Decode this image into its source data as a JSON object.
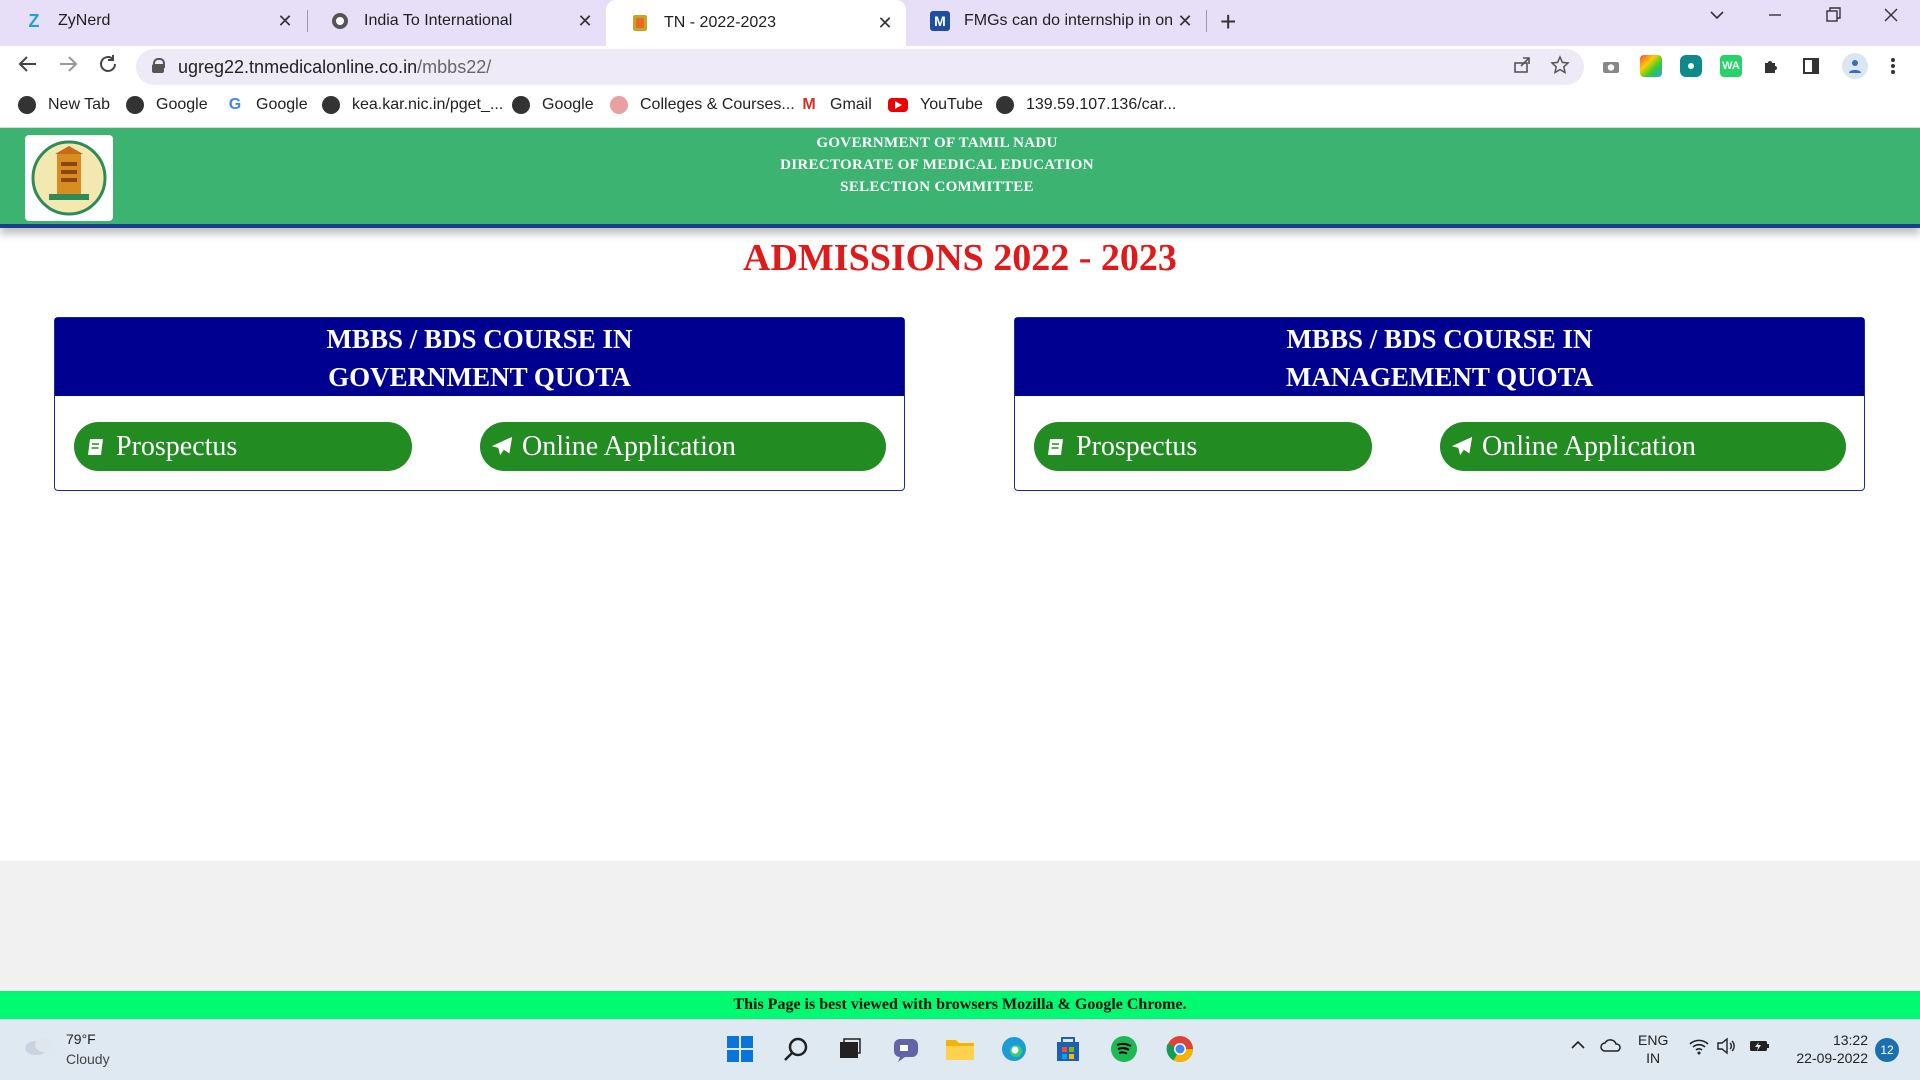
{
  "browser": {
    "tabs": [
      {
        "title": "ZyNerd",
        "favicon": "zynerd-icon",
        "active": false
      },
      {
        "title": "India To International",
        "favicon": "globe-icon",
        "active": false
      },
      {
        "title": "TN - 2022-2023",
        "favicon": "tn-emblem-icon",
        "active": true
      },
      {
        "title": "FMGs can do internship in only N",
        "favicon": "m-logo-icon",
        "active": false
      }
    ],
    "tab_close_glyph": "✕",
    "new_tab_glyph": "+",
    "url_host": "ugreg22.tnmedicalonline.co.in",
    "url_path": "/mbbs22/",
    "bookmarks": [
      {
        "label": "New Tab",
        "icon": "globe-icon"
      },
      {
        "label": "Google",
        "icon": "globe-icon"
      },
      {
        "label": "Google",
        "icon": "google-icon"
      },
      {
        "label": "kea.kar.nic.in/pget_...",
        "icon": "globe-icon"
      },
      {
        "label": "Google",
        "icon": "globe-icon"
      },
      {
        "label": "Colleges & Courses...",
        "icon": "colleges-icon"
      },
      {
        "label": "Gmail",
        "icon": "gmail-icon"
      },
      {
        "label": "YouTube",
        "icon": "youtube-icon"
      },
      {
        "label": "139.59.107.136/car...",
        "icon": "globe-icon"
      }
    ]
  },
  "page": {
    "header": {
      "line1": "GOVERNMENT OF TAMIL NADU",
      "line2": "DIRECTORATE OF MEDICAL EDUCATION",
      "line3": "SELECTION COMMITTEE"
    },
    "title": "ADMISSIONS 2022 - 2023",
    "cards": [
      {
        "heading_line1": "MBBS / BDS COURSE IN",
        "heading_line2": "GOVERNMENT QUOTA",
        "prospectus_label": "Prospectus",
        "apply_label": "Online Application"
      },
      {
        "heading_line1": "MBBS / BDS COURSE IN",
        "heading_line2": "MANAGEMENT QUOTA",
        "prospectus_label": "Prospectus",
        "apply_label": "Online Application"
      }
    ],
    "footer": "This Page is best viewed with browsers Mozilla & Google Chrome."
  },
  "taskbar": {
    "temperature": "79°F",
    "weather": "Cloudy",
    "language_line1": "ENG",
    "language_line2": "IN",
    "time": "13:22",
    "date": "22-09-2022",
    "notification_count": "12"
  },
  "colors": {
    "header_green": "#3cb371",
    "card_header_navy": "#000090",
    "button_green": "#228b22",
    "title_red": "#e01a1a",
    "footer_green": "#00fa72"
  }
}
